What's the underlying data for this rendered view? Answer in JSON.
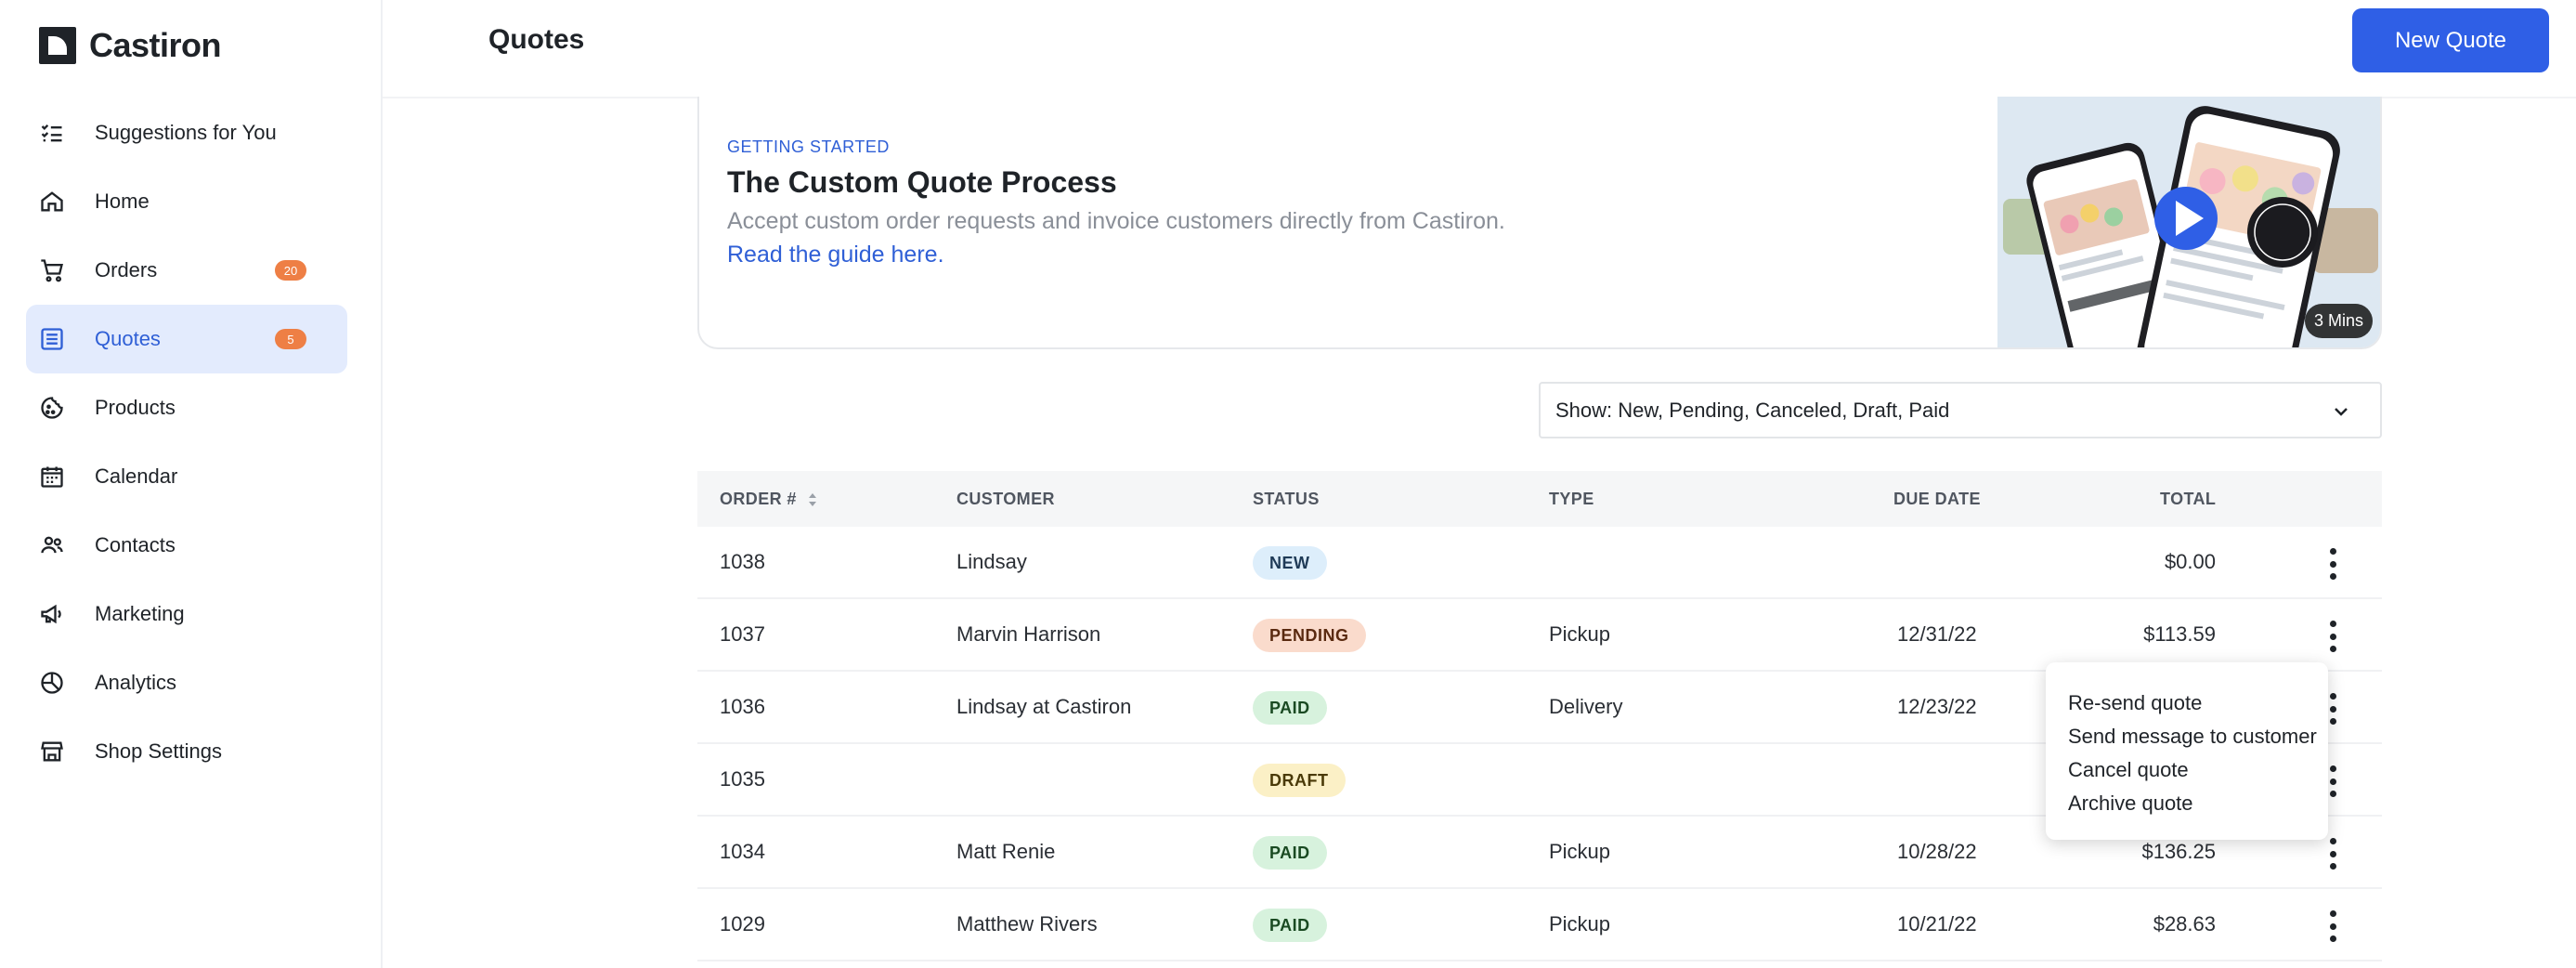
{
  "app": {
    "name": "Castiron"
  },
  "sidebar": {
    "items": [
      {
        "label": "Suggestions for You",
        "icon": "checklist-icon",
        "badge": ""
      },
      {
        "label": "Home",
        "icon": "home-icon",
        "badge": ""
      },
      {
        "label": "Orders",
        "icon": "cart-icon",
        "badge": "20"
      },
      {
        "label": "Quotes",
        "icon": "quote-list-icon",
        "badge": "5",
        "active": true
      },
      {
        "label": "Products",
        "icon": "cookie-icon",
        "badge": ""
      },
      {
        "label": "Calendar",
        "icon": "calendar-icon",
        "badge": ""
      },
      {
        "label": "Contacts",
        "icon": "contacts-icon",
        "badge": ""
      },
      {
        "label": "Marketing",
        "icon": "megaphone-icon",
        "badge": ""
      },
      {
        "label": "Analytics",
        "icon": "pie-chart-icon",
        "badge": ""
      },
      {
        "label": "Shop Settings",
        "icon": "store-icon",
        "badge": ""
      }
    ]
  },
  "header": {
    "title": "Quotes",
    "new_quote_label": "New Quote"
  },
  "guide": {
    "eyebrow": "GETTING STARTED",
    "title": "The Custom Quote Process",
    "description": "Accept custom order requests and invoice customers directly from Castiron.",
    "link": "Read the guide here.",
    "video_duration": "3 Mins"
  },
  "filter": {
    "label": "Show: New, Pending, Canceled, Draft, Paid"
  },
  "table": {
    "columns": {
      "order": "ORDER #",
      "customer": "CUSTOMER",
      "status": "STATUS",
      "type": "TYPE",
      "due_date": "DUE DATE",
      "total": "TOTAL"
    },
    "rows": [
      {
        "order": "1038",
        "customer": "Lindsay",
        "status": "NEW",
        "status_key": "new",
        "type": "",
        "due_date": "",
        "total": "$0.00"
      },
      {
        "order": "1037",
        "customer": "Marvin Harrison",
        "status": "PENDING",
        "status_key": "pending",
        "type": "Pickup",
        "due_date": "12/31/22",
        "total": "$113.59"
      },
      {
        "order": "1036",
        "customer": "Lindsay at Castiron",
        "status": "PAID",
        "status_key": "paid",
        "type": "Delivery",
        "due_date": "12/23/22",
        "total": ""
      },
      {
        "order": "1035",
        "customer": "",
        "status": "DRAFT",
        "status_key": "draft",
        "type": "",
        "due_date": "",
        "total": ""
      },
      {
        "order": "1034",
        "customer": "Matt Renie",
        "status": "PAID",
        "status_key": "paid",
        "type": "Pickup",
        "due_date": "10/28/22",
        "total": "$136.25"
      },
      {
        "order": "1029",
        "customer": "Matthew Rivers",
        "status": "PAID",
        "status_key": "paid",
        "type": "Pickup",
        "due_date": "10/21/22",
        "total": "$28.63"
      }
    ]
  },
  "row_menu": {
    "items": [
      "Re-send quote",
      "Send message to customer",
      "Cancel quote",
      "Archive quote"
    ]
  },
  "colors": {
    "primary": "#2f5fe6",
    "active_nav_bg": "#e3ebfd",
    "badge": "#ee7f45"
  }
}
